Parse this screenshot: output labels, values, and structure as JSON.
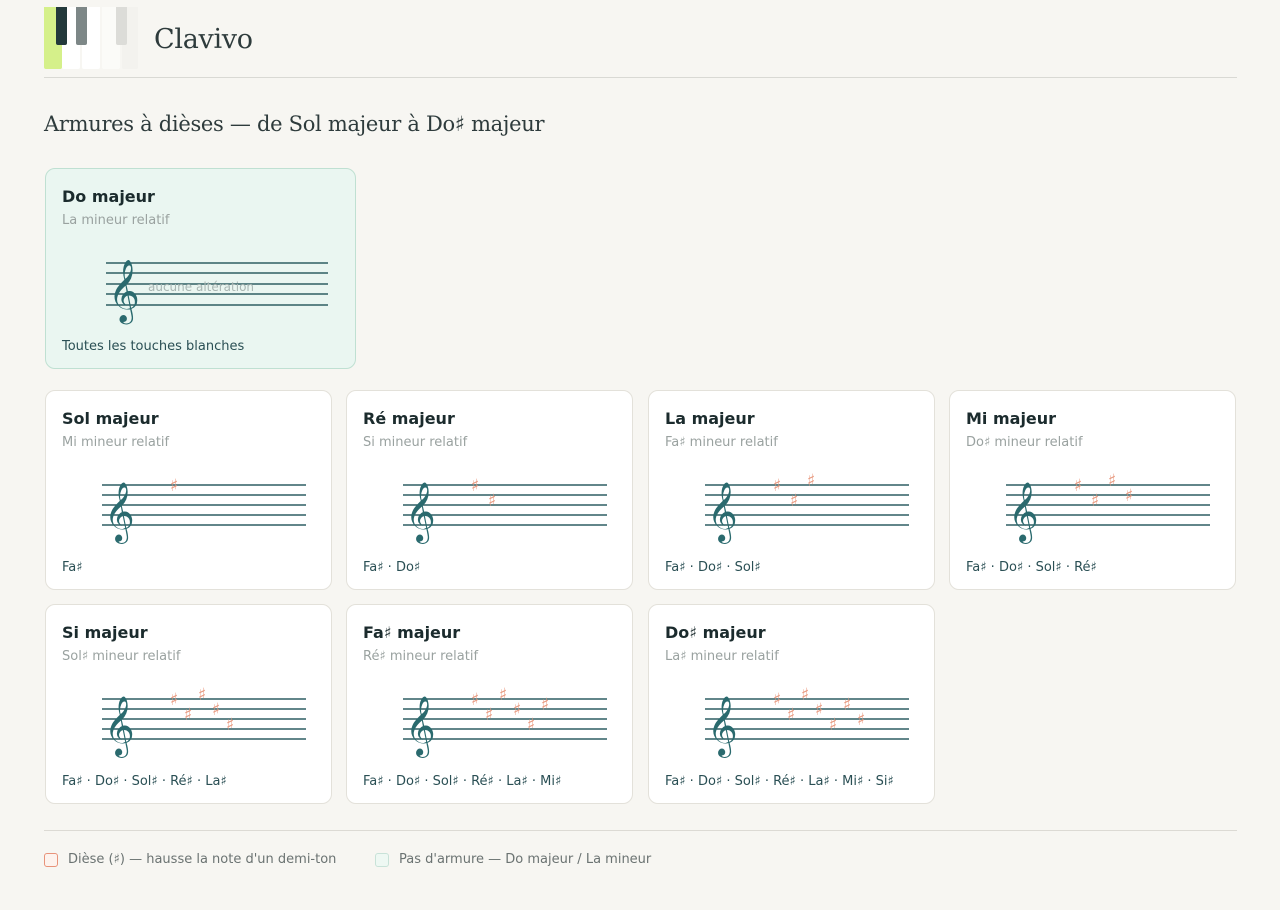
{
  "app": {
    "title": "Clavivo"
  },
  "section": {
    "title": "Armures à dièses — de Sol majeur à Do♯ majeur"
  },
  "colors": {
    "sharp": "#e89a80",
    "staff": "#2e5e63",
    "clef": "#2a6a6e",
    "tonic_bg": "#eaf6f1"
  },
  "tonic_card": {
    "name": "Do majeur",
    "relative": "La mineur relatif",
    "staff_note": "aucune altération",
    "notes": "Toutes les touches blanches"
  },
  "cards": [
    {
      "name": "Sol majeur",
      "relative": "Mi mineur relatif",
      "sharps": 1,
      "notes": "Fa♯"
    },
    {
      "name": "Ré majeur",
      "relative": "Si mineur relatif",
      "sharps": 2,
      "notes": "Fa♯ · Do♯"
    },
    {
      "name": "La majeur",
      "relative": "Fa♯ mineur relatif",
      "sharps": 3,
      "notes": "Fa♯ · Do♯ · Sol♯"
    },
    {
      "name": "Mi majeur",
      "relative": "Do♯ mineur relatif",
      "sharps": 4,
      "notes": "Fa♯ · Do♯ · Sol♯ · Ré♯"
    },
    {
      "name": "Si majeur",
      "relative": "Sol♯ mineur relatif",
      "sharps": 5,
      "notes": "Fa♯ · Do♯ · Sol♯ · Ré♯ · La♯"
    },
    {
      "name": "Fa♯ majeur",
      "relative": "Ré♯ mineur relatif",
      "sharps": 6,
      "notes": "Fa♯ · Do♯ · Sol♯ · Ré♯ · La♯ · Mi♯"
    },
    {
      "name": "Do♯ majeur",
      "relative": "La♯ mineur relatif",
      "sharps": 7,
      "notes": "Fa♯ · Do♯ · Sol♯ · Ré♯ · La♯ · Mi♯ · Si♯"
    }
  ],
  "legend": {
    "sharp": "Dièse (♯) — hausse la note d'un demi-ton",
    "no_key": "Pas d'armure — Do majeur / La mineur"
  }
}
